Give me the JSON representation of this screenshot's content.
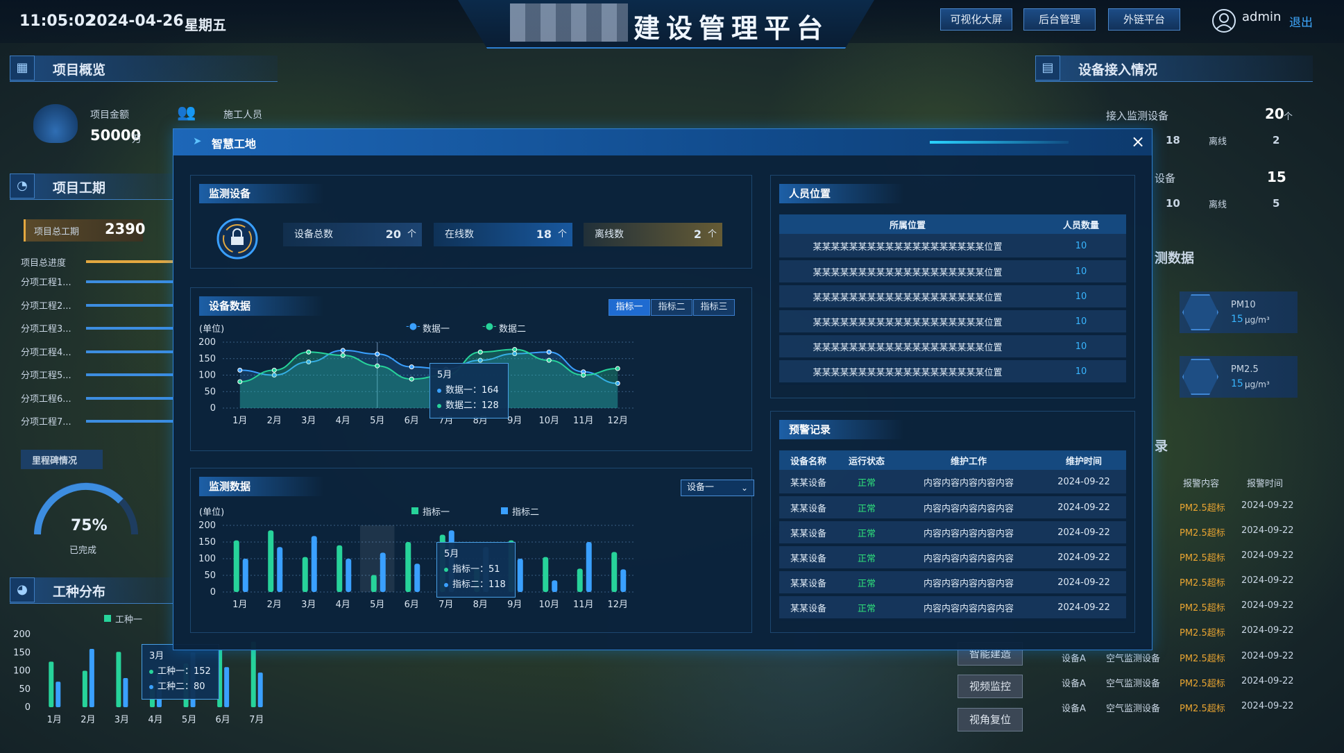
{
  "header": {
    "time": "11:05:02",
    "date": "2024-04-26",
    "weekday": "星期五",
    "title": "建设管理平台",
    "buttons": [
      "可视化大屏",
      "后台管理",
      "外链平台"
    ],
    "user": "admin",
    "logout": "退出"
  },
  "left": {
    "overview_title": "项目概览",
    "amount_label": "项目金额",
    "amount_value": "50000",
    "amount_unit": "万",
    "workers_label": "施工人员",
    "period_title": "项目工期",
    "total_label": "项目总工期",
    "total_value": "2390",
    "total_progress_label": "项目总进度",
    "sub_items": [
      "分项工程1...",
      "分项工程2...",
      "分项工程3...",
      "分项工程4...",
      "分项工程5...",
      "分项工程6...",
      "分项工程7..."
    ],
    "milestone_label": "里程碑情况",
    "gauge_value": "75%",
    "gauge_label": "已完成",
    "work_title": "工种分布",
    "work_legend": "工种一",
    "work_y_ticks": [
      "200",
      "150",
      "100",
      "50",
      "0"
    ],
    "work_x": [
      "1月",
      "2月",
      "3月",
      "4月",
      "5月",
      "6月",
      "7月"
    ],
    "work_tooltip": {
      "month": "3月",
      "a": "工种一：152",
      "b": "工种二：80"
    }
  },
  "right": {
    "access_title": "设备接入情况",
    "monitor_label": "接入监测设备",
    "monitor_value": "20",
    "unit": "个",
    "online1": "18",
    "offline_label": "离线",
    "offline1": "2",
    "second_suffix": "设备",
    "second_value": "15",
    "online2": "10",
    "offline2": "5",
    "data_suffix": "测数据",
    "pm10_label": "PM10",
    "pm10_value": "15",
    "pm_unit": "μg/m³",
    "pm25_label": "PM2.5",
    "pm25_value": "15",
    "alarm_suffix": "录",
    "alarm_headers": [
      "报警内容",
      "报警时间"
    ],
    "alarm_rows": [
      {
        "c1": "设备A",
        "c2": "空气监测设备",
        "content": "PM2.5超标",
        "time": "2024-09-22"
      },
      {
        "c1": "设备A",
        "c2": "空气监测设备",
        "content": "PM2.5超标",
        "time": "2024-09-22"
      },
      {
        "c1": "设备A",
        "c2": "空气监测设备",
        "content": "PM2.5超标",
        "time": "2024-09-22"
      }
    ],
    "partial_rows": [
      {
        "content": "PM2.5超标",
        "time": "2024-09-22"
      },
      {
        "content": "PM2.5超标",
        "time": "2024-09-22"
      },
      {
        "content": "PM2.5超标",
        "time": "2024-09-22"
      },
      {
        "content": "PM2.5超标",
        "time": "2024-09-22"
      },
      {
        "content": "PM2.5超标",
        "time": "2024-09-22"
      },
      {
        "content": "PM2.5超标",
        "time": "2024-09-22"
      }
    ],
    "side_buttons": [
      "智能建造",
      "视频监控",
      "视角复位"
    ]
  },
  "modal": {
    "title": "智慧工地",
    "monitor": {
      "title": "监测设备",
      "total_label": "设备总数",
      "total": "20",
      "online_label": "在线数",
      "online": "18",
      "offline_label": "离线数",
      "offline": "2",
      "unit": "个"
    },
    "device_data": {
      "title": "设备数据",
      "tabs": [
        "指标一",
        "指标二",
        "指标三"
      ],
      "unit_label": "(单位)",
      "legend": [
        "数据一",
        "数据二"
      ],
      "tooltip": {
        "month": "5月",
        "a": "数据一：164",
        "b": "数据二：128"
      }
    },
    "monitor_data": {
      "title": "监测数据",
      "select": "设备一",
      "unit_label": "(单位)",
      "legend": [
        "指标一",
        "指标二"
      ],
      "tooltip": {
        "month": "5月",
        "a": "指标一：51",
        "b": "指标二：118"
      }
    },
    "people": {
      "title": "人员位置",
      "headers": [
        "所属位置",
        "人员数量"
      ],
      "rows": [
        {
          "loc": "某某某某某某某某某某某某某某某某某某某位置",
          "n": "10"
        },
        {
          "loc": "某某某某某某某某某某某某某某某某某某某位置",
          "n": "10"
        },
        {
          "loc": "某某某某某某某某某某某某某某某某某某某位置",
          "n": "10"
        },
        {
          "loc": "某某某某某某某某某某某某某某某某某某某位置",
          "n": "10"
        },
        {
          "loc": "某某某某某某某某某某某某某某某某某某某位置",
          "n": "10"
        },
        {
          "loc": "某某某某某某某某某某某某某某某某某某某位置",
          "n": "10"
        }
      ]
    },
    "warning": {
      "title": "预警记录",
      "headers": [
        "设备名称",
        "运行状态",
        "维护工作",
        "维护时间"
      ],
      "rows": [
        {
          "name": "某某设备",
          "status": "正常",
          "work": "内容内容内容内容内容",
          "time": "2024-09-22"
        },
        {
          "name": "某某设备",
          "status": "正常",
          "work": "内容内容内容内容内容",
          "time": "2024-09-22"
        },
        {
          "name": "某某设备",
          "status": "正常",
          "work": "内容内容内容内容内容",
          "time": "2024-09-22"
        },
        {
          "name": "某某设备",
          "status": "正常",
          "work": "内容内容内容内容内容",
          "time": "2024-09-22"
        },
        {
          "name": "某某设备",
          "status": "正常",
          "work": "内容内容内容内容内容",
          "time": "2024-09-22"
        },
        {
          "name": "某某设备",
          "status": "正常",
          "work": "内容内容内容内容内容",
          "time": "2024-09-22"
        }
      ]
    }
  },
  "colors": {
    "accent": "#1f6bd1",
    "series1": "#3aa0ff",
    "series2": "#27d39a",
    "ok": "#2ee07a",
    "warn": "#e8a431"
  },
  "chart_data": [
    {
      "type": "line",
      "title": "设备数据",
      "ylabel": "(单位)",
      "ylim": [
        0,
        200
      ],
      "y_ticks": [
        "200",
        "150",
        "100",
        "50",
        "0"
      ],
      "categories": [
        "1月",
        "2月",
        "3月",
        "4月",
        "5月",
        "6月",
        "7月",
        "8月",
        "9月",
        "10月",
        "11月",
        "12月"
      ],
      "series": [
        {
          "name": "数据一",
          "values": [
            115,
            100,
            140,
            175,
            164,
            125,
            118,
            145,
            165,
            170,
            110,
            75
          ]
        },
        {
          "name": "数据二",
          "values": [
            80,
            115,
            170,
            160,
            128,
            88,
            100,
            170,
            178,
            145,
            100,
            120
          ]
        }
      ]
    },
    {
      "type": "bar",
      "title": "监测数据",
      "ylabel": "(单位)",
      "ylim": [
        0,
        200
      ],
      "y_ticks": [
        "200",
        "150",
        "100",
        "50",
        "0"
      ],
      "categories": [
        "1月",
        "2月",
        "3月",
        "4月",
        "5月",
        "6月",
        "7月",
        "8月",
        "9月",
        "10月",
        "11月",
        "12月"
      ],
      "series": [
        {
          "name": "指标一",
          "values": [
            155,
            185,
            105,
            140,
            51,
            150,
            172,
            70,
            155,
            105,
            70,
            120
          ]
        },
        {
          "name": "指标二",
          "values": [
            100,
            135,
            168,
            100,
            118,
            85,
            185,
            135,
            100,
            35,
            150,
            68
          ]
        }
      ]
    },
    {
      "type": "bar",
      "title": "工种分布",
      "ylim": [
        0,
        200
      ],
      "categories": [
        "1月",
        "2月",
        "3月",
        "4月",
        "5月",
        "6月",
        "7月"
      ],
      "series": [
        {
          "name": "工种一",
          "values": [
            125,
            100,
            152,
            60,
            120,
            160,
            180
          ]
        },
        {
          "name": "工种二",
          "values": [
            70,
            160,
            80,
            90,
            150,
            110,
            95
          ]
        }
      ]
    }
  ]
}
